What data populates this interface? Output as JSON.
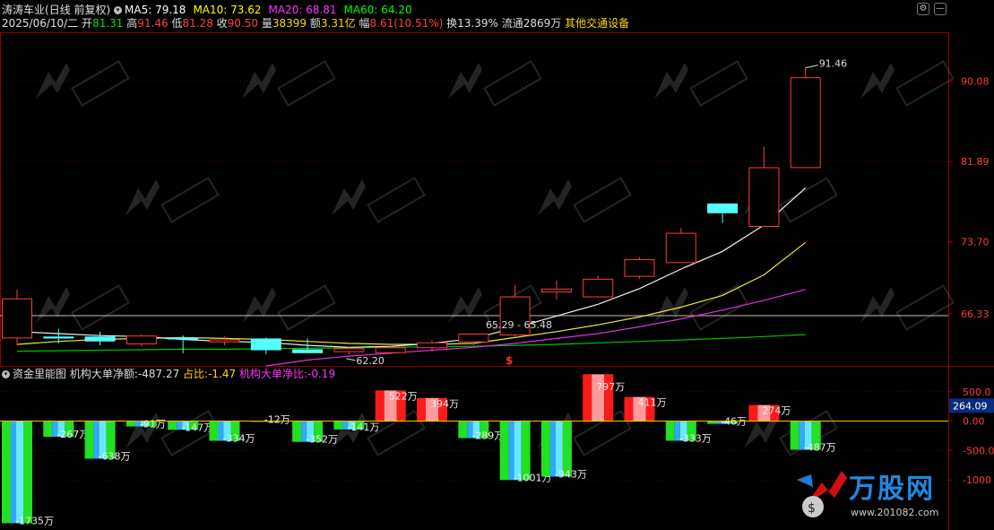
{
  "header": {
    "stock_name": "涛涛车业",
    "period": "(日线 前复权)",
    "ma": [
      {
        "label": "MA5: 79.18",
        "color": "#ffffff"
      },
      {
        "label": "MA10: 73.62",
        "color": "#ffff00"
      },
      {
        "label": "MA20: 68.81",
        "color": "#ff33ff"
      },
      {
        "label": "MA60: 64.20",
        "color": "#00ff00"
      }
    ],
    "date": "2025/06/10/二",
    "open_label": "开",
    "open": "81.31",
    "high_label": "高",
    "high": "91.46",
    "low_label": "低",
    "low": "81.28",
    "close_label": "收",
    "close": "90.50",
    "volume_label": "量",
    "volume": "38399",
    "amount_label": "额",
    "amount": "3.31亿",
    "change_label": "幅",
    "change": "8.61(10.51%)",
    "turnover": "换13.39%",
    "float": "流通2869万",
    "sector": "其他交通设备"
  },
  "indicator": {
    "name": "资金里能图",
    "net_label": "机构大单净额:",
    "net_value": "-487.27",
    "ratio_label": "占比:",
    "ratio_value": "-1.47",
    "big_ratio_label": "机构大单净比:",
    "big_ratio_value": "-0.19"
  },
  "price_axis": {
    "ticks": [
      "90.08",
      "81.89",
      "73.70",
      "66.33"
    ],
    "range": [
      61.0,
      95.0
    ]
  },
  "sub_axis": {
    "ticks": [
      "500.0",
      "0.00",
      "-500.0",
      "-1000"
    ],
    "current_tag": "264.09",
    "range": [
      -1820,
      680
    ]
  },
  "annotations": {
    "high_mark": "91.46",
    "low_mark": "62.20",
    "range_mark": "65.29 - 65.48",
    "signal": "$"
  },
  "chart_data": {
    "type": "candlestick",
    "candles": [
      {
        "o": 63.9,
        "h": 68.8,
        "l": 63.1,
        "c": 67.9
      },
      {
        "o": 64.0,
        "h": 64.8,
        "l": 63.3,
        "c": 63.8
      },
      {
        "o": 64.0,
        "h": 64.5,
        "l": 63.1,
        "c": 63.5
      },
      {
        "o": 63.3,
        "h": 64.2,
        "l": 63.0,
        "c": 64.1
      },
      {
        "o": 63.9,
        "h": 64.1,
        "l": 62.3,
        "c": 63.7
      },
      {
        "o": 63.5,
        "h": 64.0,
        "l": 63.1,
        "c": 63.7
      },
      {
        "o": 63.8,
        "h": 63.9,
        "l": 62.2,
        "c": 62.6
      },
      {
        "o": 62.7,
        "h": 63.8,
        "l": 62.3,
        "c": 62.3
      },
      {
        "o": 62.5,
        "h": 63.0,
        "l": 62.2,
        "c": 62.8
      },
      {
        "o": 62.4,
        "h": 63.0,
        "l": 62.2,
        "c": 62.9
      },
      {
        "o": 62.9,
        "h": 63.6,
        "l": 62.5,
        "c": 63.4
      },
      {
        "o": 63.5,
        "h": 64.3,
        "l": 63.1,
        "c": 64.3
      },
      {
        "o": 64.2,
        "h": 69.3,
        "l": 64.0,
        "c": 68.1
      },
      {
        "o": 68.6,
        "h": 69.7,
        "l": 67.8,
        "c": 68.9
      },
      {
        "o": 68.1,
        "h": 70.2,
        "l": 68.0,
        "c": 69.9
      },
      {
        "o": 70.2,
        "h": 72.1,
        "l": 69.9,
        "c": 71.9
      },
      {
        "o": 71.6,
        "h": 75.1,
        "l": 71.5,
        "c": 74.6
      },
      {
        "o": 77.6,
        "h": 77.6,
        "l": 75.6,
        "c": 76.6
      },
      {
        "o": 75.3,
        "h": 83.4,
        "l": 75.2,
        "c": 81.3
      },
      {
        "o": 81.31,
        "h": 91.46,
        "l": 81.28,
        "c": 90.5
      }
    ],
    "flows": [
      {
        "value": -1735,
        "label": "-1735万"
      },
      {
        "value": -267,
        "label": "-267万"
      },
      {
        "value": -638,
        "label": "-638万"
      },
      {
        "value": -91,
        "label": "-91万"
      },
      {
        "value": -147,
        "label": "-147万"
      },
      {
        "value": -334,
        "label": "-334万"
      },
      {
        "value": -12,
        "label": "-12万"
      },
      {
        "value": -352,
        "label": "-352万"
      },
      {
        "value": -141,
        "label": "-141万"
      },
      {
        "value": 522,
        "label": "522万"
      },
      {
        "value": 394,
        "label": "394万"
      },
      {
        "value": -289,
        "label": "-289万"
      },
      {
        "value": -1001,
        "label": "-1001万"
      },
      {
        "value": -943,
        "label": "-943万"
      },
      {
        "value": 797,
        "label": "797万"
      },
      {
        "value": 411,
        "label": "411万"
      },
      {
        "value": -333,
        "label": "-333万"
      },
      {
        "value": -46,
        "label": "-46万"
      },
      {
        "value": 274,
        "label": "274万"
      },
      {
        "value": -487,
        "label": "-487万"
      }
    ],
    "ma5": [
      64.5,
      64.3,
      64.1,
      64.0,
      63.7,
      63.5,
      63.4,
      63.1,
      62.9,
      63.0,
      63.3,
      63.8,
      64.9,
      66.1,
      67.3,
      68.9,
      70.9,
      72.7,
      75.4,
      79.18
    ],
    "ma10": [
      63.2,
      63.5,
      63.7,
      63.8,
      63.9,
      63.8,
      63.7,
      63.5,
      63.3,
      63.2,
      63.2,
      63.3,
      63.9,
      64.5,
      65.2,
      66.0,
      67.0,
      68.2,
      70.3,
      73.62
    ],
    "ma20": [
      null,
      null,
      null,
      null,
      null,
      null,
      61.0,
      61.6,
      62.0,
      62.3,
      62.6,
      62.9,
      63.3,
      63.8,
      64.3,
      65.0,
      65.8,
      66.7,
      67.7,
      68.81
    ],
    "ma60": [
      62.5,
      62.55,
      62.6,
      62.65,
      62.7,
      62.7,
      62.75,
      62.8,
      62.85,
      62.9,
      62.95,
      63.0,
      63.1,
      63.2,
      63.35,
      63.5,
      63.65,
      63.8,
      64.0,
      64.2
    ]
  }
}
